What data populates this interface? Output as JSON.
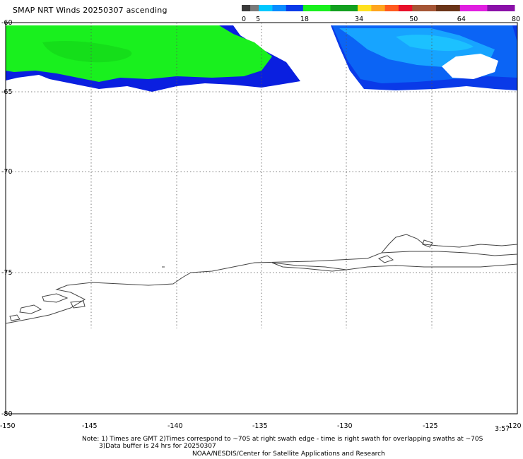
{
  "title": "SMAP NRT Winds 20250307 ascending",
  "colorbar": {
    "ticks": [
      "0",
      "5",
      "18",
      "34",
      "50",
      "64",
      "80"
    ],
    "segments": [
      {
        "from": 0,
        "to": 5,
        "color": "#555555"
      },
      {
        "from": 5,
        "to": 18,
        "color": "#1ab0ff"
      },
      {
        "from": 18,
        "to": 34,
        "color": "#13b81f"
      },
      {
        "from": 34,
        "to": 50,
        "color": "#ff3b1f"
      },
      {
        "from": 50,
        "to": 64,
        "color": "#8a4a2e"
      },
      {
        "from": 64,
        "to": 80,
        "color": "#c01fd0"
      }
    ]
  },
  "map": {
    "lat_labels": [
      "-60",
      "-65",
      "-70",
      "-75",
      "-80"
    ],
    "lon_labels": [
      "-150",
      "-145",
      "-140",
      "-135",
      "-130",
      "-125",
      "-120"
    ],
    "time_label": "3:57",
    "swath_colors": {
      "green": "#19f01e",
      "green_dark": "#12d018",
      "blue_dark": "#0a1fe0",
      "blue_mid": "#0b64f5",
      "blue_light": "#17a4ff",
      "blue_cyan": "#1ec8ff"
    }
  },
  "notes": {
    "line1": "Note: 1) Times are GMT 2)Times correspond to ~70S at right swath edge - time is right swath for overlapping swaths at ~70S",
    "line2": "3)Data buffer is 24 hrs for 20250307",
    "line3": "NOAA/NESDIS/Center for Satellite Applications and Research"
  }
}
